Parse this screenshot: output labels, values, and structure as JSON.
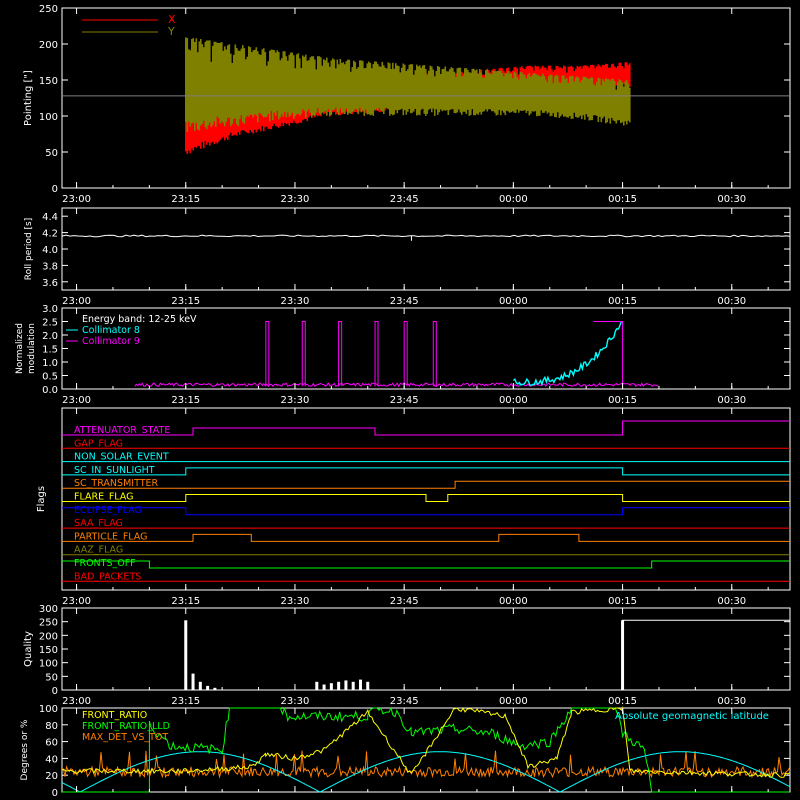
{
  "colors": {
    "background": "#000000",
    "axes": "#ffffff",
    "x": "#ff0000",
    "y": "#808000",
    "cyan": "#00ffff",
    "magenta": "#ff00ff",
    "yellow": "#ffff00",
    "green": "#00ff00",
    "orange": "#ff8000",
    "blue": "#0000ff",
    "red": "#ff0000"
  },
  "time_ticks": [
    "23:00",
    "23:15",
    "23:30",
    "23:45",
    "00:00",
    "00:15",
    "00:30"
  ],
  "chart_data": [
    {
      "id": "pointing",
      "type": "line",
      "ylabel": "Pointing [\"]",
      "ylim": [
        0,
        250
      ],
      "yticks": [
        "0",
        "50",
        "100",
        "150",
        "200",
        "250"
      ],
      "legend": [
        {
          "name": "X",
          "color": "#ff0000"
        },
        {
          "name": "Y",
          "color": "#808000"
        }
      ],
      "center_line": 128,
      "series": [
        {
          "name": "X",
          "x_start": "23:15",
          "x_end": "00:16",
          "env_min": [
            45,
            70,
            85,
            100,
            105,
            110,
            115,
            125,
            130,
            140
          ],
          "env_max": [
            125,
            130,
            140,
            155,
            160,
            160,
            165,
            170,
            170,
            175
          ]
        },
        {
          "name": "Y",
          "x_start": "23:15",
          "x_end": "00:16",
          "env_min": [
            75,
            85,
            95,
            100,
            100,
            100,
            100,
            100,
            95,
            85
          ],
          "env_max": [
            210,
            200,
            190,
            180,
            175,
            170,
            165,
            160,
            155,
            150
          ]
        }
      ]
    },
    {
      "id": "roll",
      "type": "line",
      "ylabel": "Roll period [s]",
      "ylim": [
        3.5,
        4.5
      ],
      "yticks": [
        "3.6",
        "3.8",
        "4.0",
        "4.2",
        "4.4"
      ],
      "series": [
        {
          "name": "Roll period",
          "x_start": "22:58",
          "x_end": "00:38",
          "value": 4.16,
          "dip_at": "23:46",
          "dip_value": 4.1
        }
      ]
    },
    {
      "id": "modulation",
      "type": "line",
      "ylabel": "Normalized modulation",
      "ylim": [
        0,
        3.0
      ],
      "yticks": [
        "0.0",
        "0.5",
        "1.0",
        "1.5",
        "2.0",
        "2.5",
        "3.0"
      ],
      "legend": [
        {
          "name": "Energy band: 12-25 keV",
          "color": "#ffffff"
        },
        {
          "name": "Collimator 8",
          "color": "#00ffff"
        },
        {
          "name": "Collimator 9",
          "color": "#ff00ff"
        }
      ],
      "spikes": [
        "23:26",
        "23:31",
        "23:36",
        "23:41",
        "23:45",
        "23:49"
      ],
      "spike_value": 2.5,
      "rise": {
        "x_start": "00:00",
        "x_end": "00:15",
        "y_start": 0.2,
        "y_end": 2.5
      },
      "baseline": 0.1
    },
    {
      "id": "flags",
      "type": "timeline",
      "ylabel": "Flags",
      "rows": [
        {
          "name": "ATTENUATOR_STATE",
          "color": "#ff00ff",
          "segments": [
            [
              "22:58",
              0
            ],
            [
              "23:16",
              1
            ],
            [
              "23:41",
              0
            ],
            [
              "00:15",
              2
            ]
          ]
        },
        {
          "name": "GAP_FLAG",
          "color": "#ff0000",
          "segments": [
            [
              "22:58",
              0
            ]
          ]
        },
        {
          "name": "NON_SOLAR_EVENT",
          "color": "#00ffff",
          "segments": [
            [
              "22:58",
              0
            ]
          ]
        },
        {
          "name": "SC_IN_SUNLIGHT",
          "color": "#00ffff",
          "segments": [
            [
              "22:58",
              0
            ],
            [
              "23:15",
              1
            ],
            [
              "00:15",
              0
            ]
          ]
        },
        {
          "name": "SC_TRANSMITTER",
          "color": "#ff8000",
          "segments": [
            [
              "22:58",
              0
            ],
            [
              "23:52",
              1
            ]
          ]
        },
        {
          "name": "FLARE_FLAG",
          "color": "#ffff00",
          "segments": [
            [
              "22:58",
              0
            ],
            [
              "23:15",
              1
            ],
            [
              "23:48",
              0
            ],
            [
              "23:51",
              1
            ],
            [
              "00:15",
              0
            ]
          ]
        },
        {
          "name": "ECLIPSE_FLAG",
          "color": "#0000ff",
          "segments": [
            [
              "22:58",
              1
            ],
            [
              "23:15",
              0
            ],
            [
              "00:15",
              1
            ]
          ]
        },
        {
          "name": "SAA_FLAG",
          "color": "#ff0000",
          "segments": [
            [
              "22:58",
              0
            ]
          ]
        },
        {
          "name": "PARTICLE_FLAG",
          "color": "#ff8000",
          "segments": [
            [
              "22:58",
              0
            ],
            [
              "23:16",
              1
            ],
            [
              "23:24",
              0
            ],
            [
              "23:58",
              1
            ],
            [
              "00:09",
              0
            ]
          ]
        },
        {
          "name": "AAZ_FLAG",
          "color": "#808000",
          "segments": [
            [
              "22:58",
              0
            ]
          ]
        },
        {
          "name": "FRONTS_OFF",
          "color": "#00ff00",
          "segments": [
            [
              "22:58",
              1
            ],
            [
              "23:10",
              0
            ],
            [
              "00:19",
              1
            ]
          ]
        },
        {
          "name": "BAD_PACKETS",
          "color": "#ff0000",
          "segments": [
            [
              "22:58",
              0
            ]
          ]
        }
      ]
    },
    {
      "id": "quality",
      "type": "bar",
      "ylabel": "Quality",
      "ylim": [
        0,
        300
      ],
      "yticks": [
        "0",
        "50",
        "100",
        "150",
        "200",
        "250",
        "300"
      ],
      "bars": [
        [
          "23:15",
          255
        ],
        [
          "23:16",
          60
        ],
        [
          "23:17",
          30
        ],
        [
          "23:18",
          15
        ],
        [
          "23:19",
          8
        ],
        [
          "23:33",
          30
        ],
        [
          "23:34",
          20
        ],
        [
          "23:35",
          25
        ],
        [
          "23:36",
          30
        ],
        [
          "23:37",
          35
        ],
        [
          "23:38",
          30
        ],
        [
          "23:39",
          38
        ],
        [
          "23:40",
          30
        ],
        [
          "00:15",
          255
        ]
      ],
      "block": {
        "x_start": "00:15",
        "x_end": "00:38",
        "value": 255
      }
    },
    {
      "id": "fractions",
      "type": "line",
      "ylabel": "Degrees or %",
      "ylim": [
        0,
        100
      ],
      "yticks": [
        "0",
        "20",
        "40",
        "60",
        "80",
        "100"
      ],
      "legend": [
        {
          "name": "FRONT_RATIO",
          "color": "#ffff00"
        },
        {
          "name": "FRONT_RATIO_LLD",
          "color": "#00ff00"
        },
        {
          "name": "MAX_DET_VS_TOT",
          "color": "#ff8000"
        }
      ],
      "right_label": {
        "text": "Absolute geomagnetic latitude",
        "color": "#00ffff"
      }
    }
  ]
}
